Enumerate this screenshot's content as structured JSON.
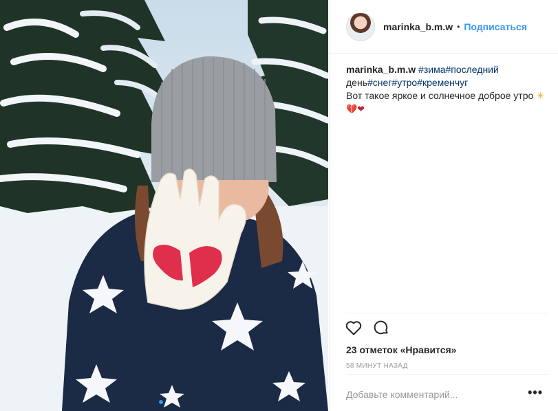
{
  "photo": {
    "alt_icon": "photo",
    "carousel_dots": 2,
    "active_dot": 0
  },
  "header": {
    "username": "marinka_b.m.w",
    "separator": "•",
    "follow_label": "Подписаться"
  },
  "caption": {
    "username": "marinka_b.m.w",
    "tags_line1": [
      "#зима",
      "#последний"
    ],
    "line2_prefix": "день",
    "tags_line2": [
      "#снег",
      "#утро",
      "#кременчуг"
    ],
    "text": "Вот такое яркое и солнечное доброе утро",
    "sun_emoji": "☀",
    "hearts": "💔❤"
  },
  "actions": {
    "like_icon": "heart-outline-icon",
    "comment_icon": "comment-bubble-icon"
  },
  "likes_text": "23 отметок «Нравится»",
  "time_text": "58 минут назад",
  "comment": {
    "placeholder": "Добавьте комментарий...",
    "more_label": "•••"
  },
  "colors": {
    "link_blue": "#3897f0",
    "hashtag": "#003569",
    "muted": "#999999",
    "text": "#262626"
  }
}
